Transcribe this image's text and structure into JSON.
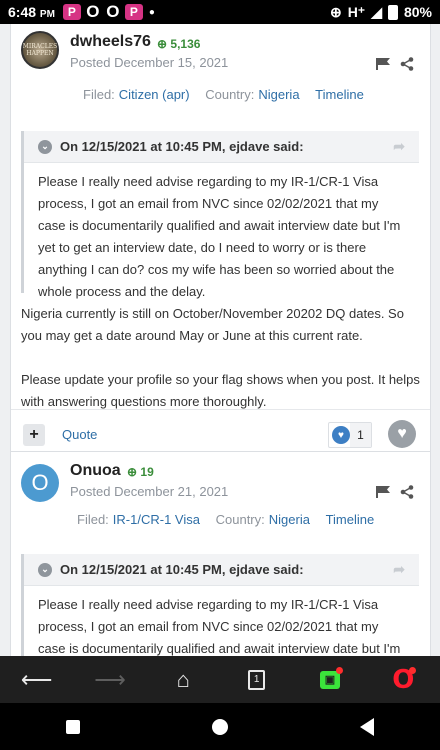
{
  "status_bar": {
    "time": "6:48",
    "time_suffix": "PM",
    "notification_icons": [
      "P",
      "O",
      "O",
      "P"
    ],
    "network": "H⁺",
    "battery": "80%"
  },
  "posts": [
    {
      "username": "dwheels76",
      "reputation": "5,136",
      "avatar_text": "MIRACLES HAPPEN",
      "posted": "Posted December 15, 2021",
      "filed_label": "Filed:",
      "filed_value": "Citizen (apr)",
      "country_label": "Country:",
      "country_value": "Nigeria",
      "timeline_label": "Timeline",
      "quote_header": "On 12/15/2021 at 10:45 PM, ejdave said:",
      "quote_text": "Please I really need advise regarding to my IR-1/CR-1 Visa process, I got an email from NVC since 02/02/2021 that my case is documentarily qualified and await interview date but I'm yet to get an interview date, do I need to worry or is there anything I can do? cos my wife has been so worried about the whole process and the delay.",
      "body_1": "Nigeria currently is still on October/November 20202 DQ dates. So you may get a date around May or June at this current rate.",
      "body_2": "Please update your profile so your flag shows when you post. It helps with answering questions more thoroughly.",
      "quote_button": "Quote",
      "reaction_count": "1"
    },
    {
      "username": "Onuoa",
      "reputation": "19",
      "avatar_letter": "O",
      "posted": "Posted December 21, 2021",
      "filed_label": "Filed:",
      "filed_value": "IR-1/CR-1 Visa",
      "country_label": "Country:",
      "country_value": "Nigeria",
      "timeline_label": "Timeline",
      "quote_header": "On 12/15/2021 at 10:45 PM, ejdave said:",
      "quote_text": "Please I really need advise regarding to my IR-1/CR-1 Visa process, I got an email from NVC since 02/02/2021 that my case is documentarily qualified and await interview date but I'm yet to get an interview date, do I need to worry or is there anything I can"
    }
  ],
  "browser_nav": {
    "tabs_count": "1"
  }
}
